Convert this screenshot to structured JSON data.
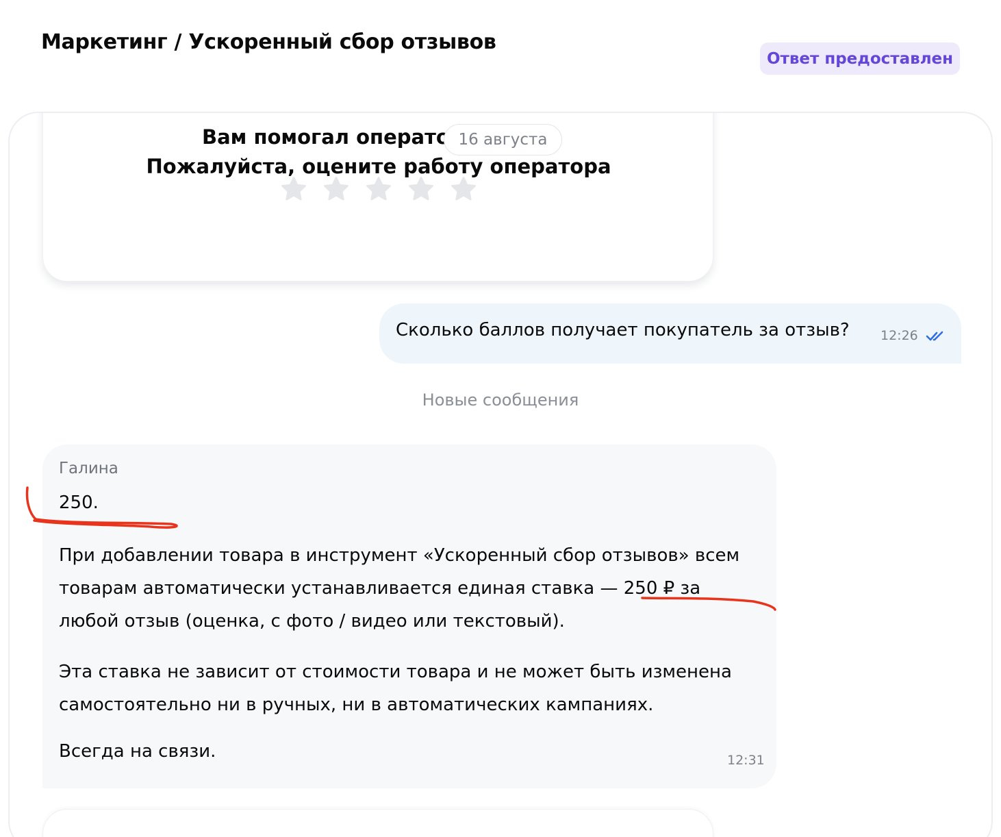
{
  "header": {
    "breadcrumb": "Маркетинг / Ускоренный сбор отзывов",
    "status_badge": "Ответ предоставлен"
  },
  "rating_card": {
    "line1": "Вам помогал операто",
    "line2": "Пожалуйста, оцените работу оператора",
    "stars_total": 5,
    "stars_selected": 0,
    "star_icon": "star-icon"
  },
  "date_separator": "16 августа",
  "outgoing_message": {
    "text": "Сколько баллов получает покупатель за отзыв?",
    "time": "12:26",
    "status_icon": "double-check-icon"
  },
  "new_messages_divider": "Новые сообщения",
  "incoming_message": {
    "sender": "Галина",
    "short_answer": "250.",
    "paragraph1": "При добавлении товара в инструмент «Ускоренный сбор отзывов» всем товарам автоматически устанавливается единая ставка — 250 ₽ за любой отзыв (оценка, с фото / видео или текстовый).",
    "paragraph2": "Эта ставка не зависит от стоимости товара и не может быть изменена самостоятельно ни в ручных, ни в автоматических кампаниях.",
    "paragraph3": "Всегда на связи.",
    "time": "12:31"
  },
  "colors": {
    "badge_bg": "#eeeafb",
    "badge_text": "#6547d8",
    "outgoing_bubble": "#eef5fb",
    "incoming_bubble": "#f7f8fa",
    "check_blue": "#2f6fe0",
    "annotation_red": "#e8341c"
  }
}
